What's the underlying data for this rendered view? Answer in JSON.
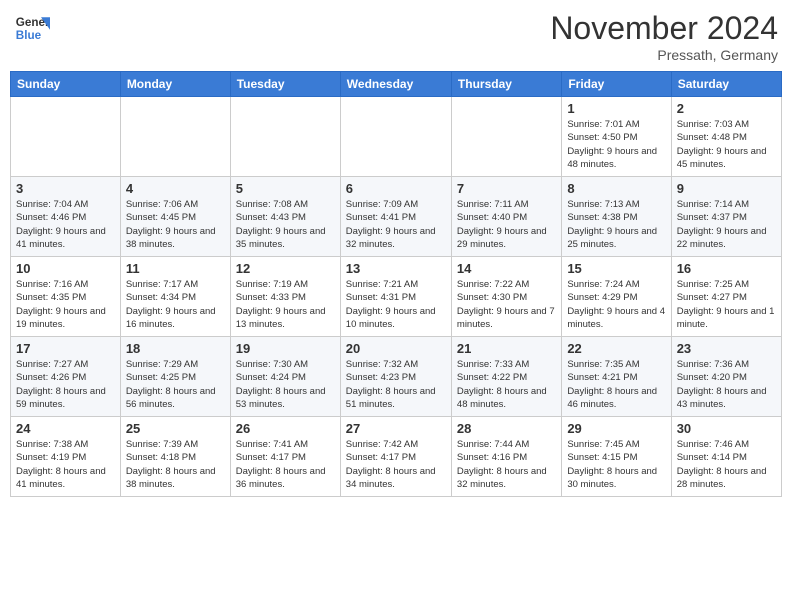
{
  "header": {
    "logo_line1": "General",
    "logo_line2": "Blue",
    "month": "November 2024",
    "location": "Pressath, Germany"
  },
  "days_of_week": [
    "Sunday",
    "Monday",
    "Tuesday",
    "Wednesday",
    "Thursday",
    "Friday",
    "Saturday"
  ],
  "weeks": [
    [
      {
        "day": "",
        "info": ""
      },
      {
        "day": "",
        "info": ""
      },
      {
        "day": "",
        "info": ""
      },
      {
        "day": "",
        "info": ""
      },
      {
        "day": "",
        "info": ""
      },
      {
        "day": "1",
        "info": "Sunrise: 7:01 AM\nSunset: 4:50 PM\nDaylight: 9 hours and 48 minutes."
      },
      {
        "day": "2",
        "info": "Sunrise: 7:03 AM\nSunset: 4:48 PM\nDaylight: 9 hours and 45 minutes."
      }
    ],
    [
      {
        "day": "3",
        "info": "Sunrise: 7:04 AM\nSunset: 4:46 PM\nDaylight: 9 hours and 41 minutes."
      },
      {
        "day": "4",
        "info": "Sunrise: 7:06 AM\nSunset: 4:45 PM\nDaylight: 9 hours and 38 minutes."
      },
      {
        "day": "5",
        "info": "Sunrise: 7:08 AM\nSunset: 4:43 PM\nDaylight: 9 hours and 35 minutes."
      },
      {
        "day": "6",
        "info": "Sunrise: 7:09 AM\nSunset: 4:41 PM\nDaylight: 9 hours and 32 minutes."
      },
      {
        "day": "7",
        "info": "Sunrise: 7:11 AM\nSunset: 4:40 PM\nDaylight: 9 hours and 29 minutes."
      },
      {
        "day": "8",
        "info": "Sunrise: 7:13 AM\nSunset: 4:38 PM\nDaylight: 9 hours and 25 minutes."
      },
      {
        "day": "9",
        "info": "Sunrise: 7:14 AM\nSunset: 4:37 PM\nDaylight: 9 hours and 22 minutes."
      }
    ],
    [
      {
        "day": "10",
        "info": "Sunrise: 7:16 AM\nSunset: 4:35 PM\nDaylight: 9 hours and 19 minutes."
      },
      {
        "day": "11",
        "info": "Sunrise: 7:17 AM\nSunset: 4:34 PM\nDaylight: 9 hours and 16 minutes."
      },
      {
        "day": "12",
        "info": "Sunrise: 7:19 AM\nSunset: 4:33 PM\nDaylight: 9 hours and 13 minutes."
      },
      {
        "day": "13",
        "info": "Sunrise: 7:21 AM\nSunset: 4:31 PM\nDaylight: 9 hours and 10 minutes."
      },
      {
        "day": "14",
        "info": "Sunrise: 7:22 AM\nSunset: 4:30 PM\nDaylight: 9 hours and 7 minutes."
      },
      {
        "day": "15",
        "info": "Sunrise: 7:24 AM\nSunset: 4:29 PM\nDaylight: 9 hours and 4 minutes."
      },
      {
        "day": "16",
        "info": "Sunrise: 7:25 AM\nSunset: 4:27 PM\nDaylight: 9 hours and 1 minute."
      }
    ],
    [
      {
        "day": "17",
        "info": "Sunrise: 7:27 AM\nSunset: 4:26 PM\nDaylight: 8 hours and 59 minutes."
      },
      {
        "day": "18",
        "info": "Sunrise: 7:29 AM\nSunset: 4:25 PM\nDaylight: 8 hours and 56 minutes."
      },
      {
        "day": "19",
        "info": "Sunrise: 7:30 AM\nSunset: 4:24 PM\nDaylight: 8 hours and 53 minutes."
      },
      {
        "day": "20",
        "info": "Sunrise: 7:32 AM\nSunset: 4:23 PM\nDaylight: 8 hours and 51 minutes."
      },
      {
        "day": "21",
        "info": "Sunrise: 7:33 AM\nSunset: 4:22 PM\nDaylight: 8 hours and 48 minutes."
      },
      {
        "day": "22",
        "info": "Sunrise: 7:35 AM\nSunset: 4:21 PM\nDaylight: 8 hours and 46 minutes."
      },
      {
        "day": "23",
        "info": "Sunrise: 7:36 AM\nSunset: 4:20 PM\nDaylight: 8 hours and 43 minutes."
      }
    ],
    [
      {
        "day": "24",
        "info": "Sunrise: 7:38 AM\nSunset: 4:19 PM\nDaylight: 8 hours and 41 minutes."
      },
      {
        "day": "25",
        "info": "Sunrise: 7:39 AM\nSunset: 4:18 PM\nDaylight: 8 hours and 38 minutes."
      },
      {
        "day": "26",
        "info": "Sunrise: 7:41 AM\nSunset: 4:17 PM\nDaylight: 8 hours and 36 minutes."
      },
      {
        "day": "27",
        "info": "Sunrise: 7:42 AM\nSunset: 4:17 PM\nDaylight: 8 hours and 34 minutes."
      },
      {
        "day": "28",
        "info": "Sunrise: 7:44 AM\nSunset: 4:16 PM\nDaylight: 8 hours and 32 minutes."
      },
      {
        "day": "29",
        "info": "Sunrise: 7:45 AM\nSunset: 4:15 PM\nDaylight: 8 hours and 30 minutes."
      },
      {
        "day": "30",
        "info": "Sunrise: 7:46 AM\nSunset: 4:14 PM\nDaylight: 8 hours and 28 minutes."
      }
    ]
  ]
}
